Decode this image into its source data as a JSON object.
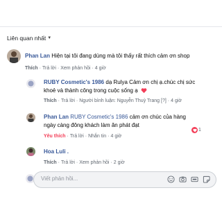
{
  "header": {
    "sort_label": "Liên quan nhất"
  },
  "comments": [
    {
      "author": "Phan Lan",
      "text": "Hiện tại tôi đang dùng mà tôi thấy rất thích cảm ơn shop",
      "actions": {
        "like": "Thích",
        "reply": "Trả lời",
        "edit_history": "Xem phản hồi",
        "time": "4 giờ"
      }
    },
    {
      "author": "RUBY Cosmetic's 1986",
      "text_line1": "dạ Rulya Cảm ơn chị ạ.chúc chị sức",
      "text_line2": "khoẻ và thành công trong cuộc sống ạ",
      "actions": {
        "like": "Thích",
        "reply": "Trả lời",
        "replier_prefix": "Người bình luận:",
        "replier_name": "Nguyễn Thuỳ Trang",
        "badge": "[?]",
        "time": "4 giờ"
      }
    },
    {
      "author": "Phan Lan",
      "mention": "RUBY Cosmetic's 1986",
      "text_line1": "cảm ơn chúc của hàng",
      "text_line2": "ngày càng đông khách làm ăn phát đạt",
      "actions": {
        "like": "Yêu thích",
        "reply": "Trả lời",
        "message": "Nhắn tin",
        "time": "4 giờ"
      },
      "reaction_count": "1"
    },
    {
      "author": "Hoa Luli .",
      "text": "",
      "actions": {
        "like": "Thích",
        "reply": "Trả lời",
        "edit_history": "Xem phản hồi",
        "time": "2 giờ"
      }
    }
  ],
  "composer": {
    "placeholder": "Viết phản hồi..."
  },
  "colors": {
    "link": "#385898",
    "meta": "#606770",
    "love": "#f33e58",
    "input_bg": "#f2f3f5"
  }
}
